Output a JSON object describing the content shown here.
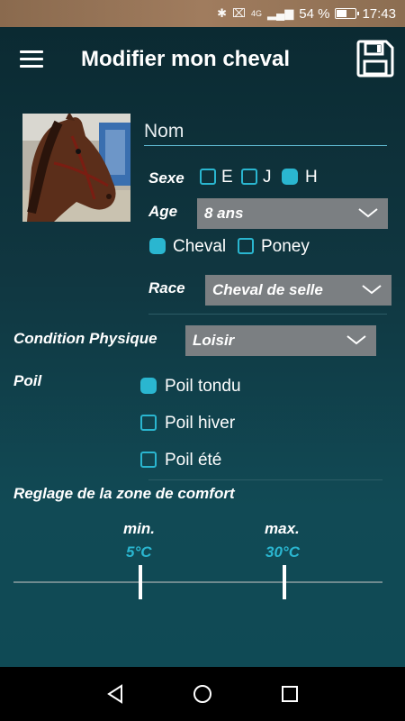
{
  "status_bar": {
    "battery": "54 %",
    "battery_level": 0.54,
    "network": "4G",
    "time": "17:43"
  },
  "toolbar": {
    "title": "Modifier mon cheval",
    "menu_icon": "hamburger-menu-icon",
    "save_icon": "floppy-disk-icon"
  },
  "horse": {
    "name_placeholder": "Nom",
    "name_value": ""
  },
  "sexe": {
    "label": "Sexe",
    "options": [
      {
        "label": "E",
        "checked": false
      },
      {
        "label": "J",
        "checked": false
      },
      {
        "label": "H",
        "checked": true
      }
    ]
  },
  "age": {
    "label": "Age",
    "value": "8 ans"
  },
  "type": {
    "options": [
      {
        "label": "Cheval",
        "checked": true
      },
      {
        "label": "Poney",
        "checked": false
      }
    ]
  },
  "race": {
    "label": "Race",
    "value": "Cheval de selle"
  },
  "condition": {
    "label": "Condition Physique",
    "value": "Loisir"
  },
  "poil": {
    "label": "Poil",
    "options": [
      {
        "label": "Poil tondu",
        "checked": true
      },
      {
        "label": "Poil hiver",
        "checked": false
      },
      {
        "label": "Poil été",
        "checked": false
      }
    ]
  },
  "comfort": {
    "label": "Reglage de la zone de comfort",
    "min_label": "min.",
    "min_value": "5°C",
    "max_label": "max.",
    "max_value": "30°C"
  },
  "colors": {
    "accent": "#2ab6d0",
    "dropdown_bg": "#7b7f82",
    "status_bar": "#9a785a"
  }
}
